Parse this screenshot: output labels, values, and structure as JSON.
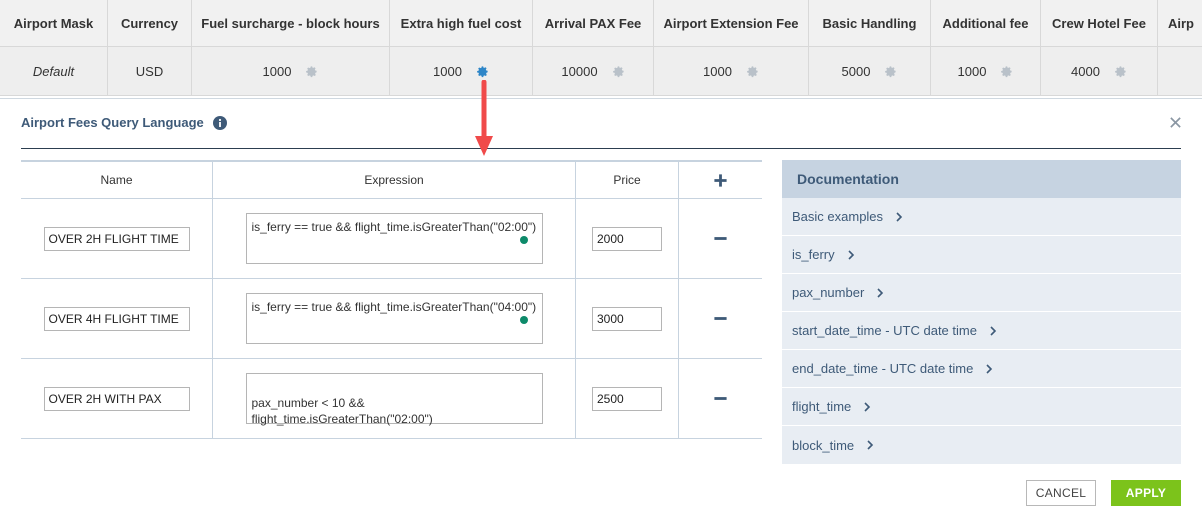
{
  "fees_table": {
    "headers": [
      "Airport Mask",
      "Currency",
      "Fuel surcharge - block hours",
      "Extra high fuel cost",
      "Arrival PAX Fee",
      "Airport Extension Fee",
      "Basic Handling",
      "Additional fee",
      "Crew Hotel Fee",
      "Airp"
    ],
    "row": {
      "airport_mask": "Default",
      "currency": "USD",
      "fuel_surcharge": "1000",
      "extra_high_fuel": "1000",
      "arrival_pax": "10000",
      "airport_extension": "1000",
      "basic_handling": "5000",
      "additional_fee": "1000",
      "crew_hotel": "4000"
    }
  },
  "dialog": {
    "title": "Airport Fees Query Language",
    "columns": {
      "name": "Name",
      "expression": "Expression",
      "price": "Price"
    },
    "rules": [
      {
        "name": "OVER 2H FLIGHT TIME",
        "expression": "is_ferry == true && flight_time.isGreaterThan(\"02:00\")",
        "price": "2000"
      },
      {
        "name": "OVER 4H FLIGHT TIME",
        "expression": "is_ferry == true && flight_time.isGreaterThan(\"04:00\")",
        "price": "3000"
      },
      {
        "name": "OVER 2H WITH PAX",
        "expression": "pax_number < 10 &&\nflight_time.isGreaterThan(\"02:00\")",
        "price": "2500"
      }
    ],
    "documentation": {
      "title": "Documentation",
      "items": [
        "Basic examples",
        "is_ferry",
        "pax_number",
        "start_date_time - UTC date time",
        "end_date_time - UTC date time",
        "flight_time",
        "block_time"
      ]
    },
    "buttons": {
      "cancel": "CANCEL",
      "apply": "APPLY"
    }
  },
  "colors": {
    "accent": "#3e5a78",
    "apply": "#7cc31b",
    "annotation_arrow": "#f04a4a",
    "status_dot": "#0d8a6a"
  },
  "icons": {
    "gear": "gear-icon",
    "info": "info-icon",
    "close": "close-icon",
    "add": "plus-icon",
    "remove": "minus-icon",
    "chevron": "chevron-right-icon"
  }
}
